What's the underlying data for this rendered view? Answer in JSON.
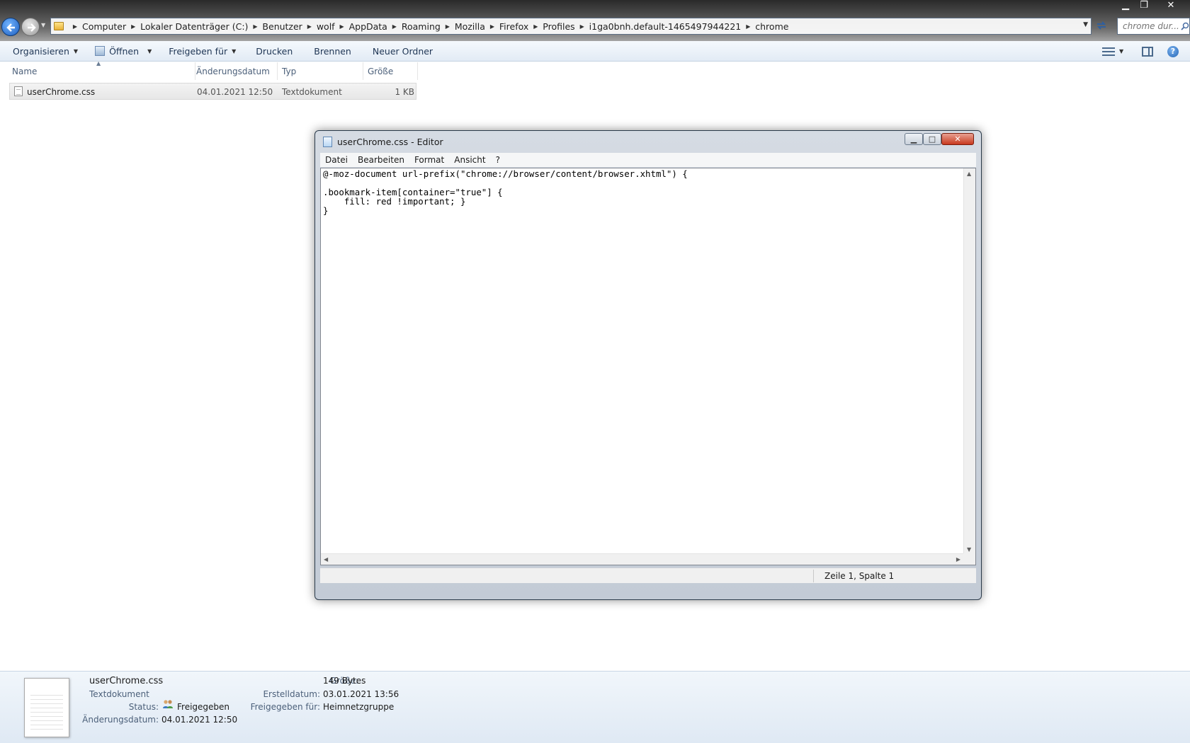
{
  "window": {
    "minimize_glyph": "▁",
    "restore_glyph": "❐",
    "close_glyph": "✕"
  },
  "navigation": {
    "back_icon": "back-arrow-icon",
    "forward_icon": "forward-arrow-icon"
  },
  "address_bar": {
    "breadcrumbs": [
      "Computer",
      "Lokaler Datenträger (C:)",
      "Benutzer",
      "wolf",
      "AppData",
      "Roaming",
      "Mozilla",
      "Firefox",
      "Profiles",
      "i1ga0bnh.default-1465497944221",
      "chrome"
    ]
  },
  "search": {
    "placeholder": "chrome dur..."
  },
  "toolbar": {
    "organize": "Organisieren",
    "open": "Öffnen",
    "share": "Freigeben für",
    "print": "Drucken",
    "burn": "Brennen",
    "new_folder": "Neuer Ordner"
  },
  "file_list": {
    "columns": {
      "name": "Name",
      "date": "Änderungsdatum",
      "type": "Typ",
      "size": "Größe"
    },
    "files": [
      {
        "name": "userChrome.css",
        "date": "04.01.2021 12:50",
        "type": "Textdokument",
        "size": "1 KB"
      }
    ]
  },
  "notepad": {
    "title": "userChrome.css - Editor",
    "menu": [
      "Datei",
      "Bearbeiten",
      "Format",
      "Ansicht",
      "?"
    ],
    "content": "@-moz-document url-prefix(\"chrome://browser/content/browser.xhtml\") {\n\n.bookmark-item[container=\"true\"] {\n    fill: red !important; }\n}",
    "status": "Zeile 1, Spalte 1"
  },
  "details": {
    "file_name": "userChrome.css",
    "file_type": "Textdokument",
    "status_label": "Status:",
    "status_value": "Freigegeben",
    "modified_label": "Änderungsdatum:",
    "modified_value": "04.01.2021 12:50",
    "size_label": "Größe:",
    "size_value": "149 Bytes",
    "created_label": "Erstelldatum:",
    "created_value": "03.01.2021 13:56",
    "shared_label": "Freigegeben für:",
    "shared_value": "Heimnetzgruppe"
  },
  "colors": {
    "accent": "#1f5fbf",
    "close_button": "#c8391e"
  }
}
